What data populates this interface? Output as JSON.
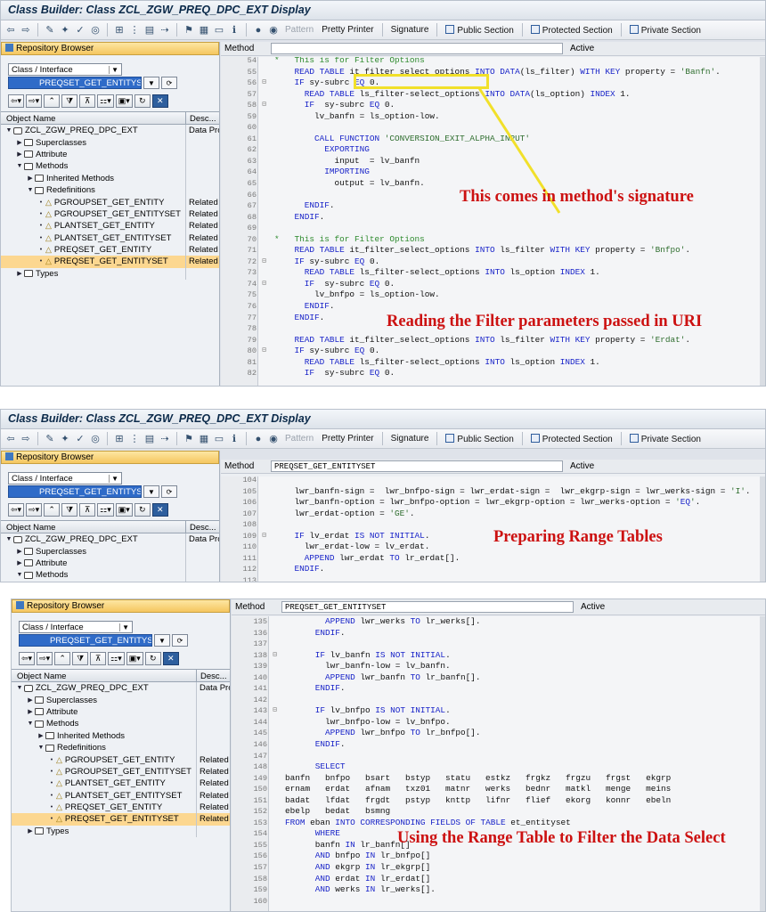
{
  "panels": [
    {
      "title": "Class Builder: Class ZCL_ZGW_PREQ_DPC_EXT Display",
      "toolbar": {
        "pattern": "Pattern",
        "pretty_printer": "Pretty Printer",
        "signature": "Signature",
        "public_section": "Public Section",
        "protected_section": "Protected Section",
        "private_section": "Private Section"
      },
      "repo_title": "Repository Browser",
      "class_select": "Class / Interface",
      "object_value": "PREQSET_GET_ENTITYSET",
      "col_object": "Object Name",
      "col_desc": "Desc...",
      "tree": [
        {
          "label": "ZCL_ZGW_PREQ_DPC_EXT",
          "desc": "Data Prov",
          "indent": 0,
          "icon": "class",
          "tw": "▼"
        },
        {
          "label": "Superclasses",
          "desc": "",
          "indent": 1,
          "icon": "folder",
          "tw": "▶"
        },
        {
          "label": "Attribute",
          "desc": "",
          "indent": 1,
          "icon": "folder",
          "tw": "▶"
        },
        {
          "label": "Methods",
          "desc": "",
          "indent": 1,
          "icon": "folder-open",
          "tw": "▼"
        },
        {
          "label": "Inherited Methods",
          "desc": "",
          "indent": 2,
          "icon": "folder",
          "tw": "▶"
        },
        {
          "label": "Redefinitions",
          "desc": "",
          "indent": 2,
          "icon": "folder-open",
          "tw": "▼"
        },
        {
          "label": "PGROUPSET_GET_ENTITY",
          "desc": "Related E",
          "indent": 3,
          "icon": "method",
          "tw": "•"
        },
        {
          "label": "PGROUPSET_GET_ENTITYSET",
          "desc": "Related E",
          "indent": 3,
          "icon": "method",
          "tw": "•"
        },
        {
          "label": "PLANTSET_GET_ENTITY",
          "desc": "Related E",
          "indent": 3,
          "icon": "method",
          "tw": "•"
        },
        {
          "label": "PLANTSET_GET_ENTITYSET",
          "desc": "Related E",
          "indent": 3,
          "icon": "method",
          "tw": "•"
        },
        {
          "label": "PREQSET_GET_ENTITY",
          "desc": "Related E",
          "indent": 3,
          "icon": "method",
          "tw": "•"
        },
        {
          "label": "PREQSET_GET_ENTITYSET",
          "desc": "Related E",
          "indent": 3,
          "icon": "method",
          "tw": "•",
          "selected": true
        },
        {
          "label": "Types",
          "desc": "",
          "indent": 1,
          "icon": "folder",
          "tw": "▶"
        }
      ],
      "method_label": "Method",
      "method_value": "",
      "method_status": "Active",
      "code": [
        {
          "n": "54",
          "t": "*   This is for Filter Options",
          "c": true
        },
        {
          "n": "55",
          "t": "    READ TABLE it_filter_select_options INTO DATA(ls_filter) WITH KEY property = 'Banfn'."
        },
        {
          "n": "56",
          "t": "    IF sy-subrc EQ 0.",
          "f": "⊟"
        },
        {
          "n": "57",
          "t": "      READ TABLE ls_filter-select_options INTO DATA(ls_option) INDEX 1."
        },
        {
          "n": "58",
          "t": "      IF  sy-subrc EQ 0.",
          "f": "⊟"
        },
        {
          "n": "59",
          "t": "        lv_banfn = ls_option-low."
        },
        {
          "n": "60",
          "t": ""
        },
        {
          "n": "61",
          "t": "        CALL FUNCTION 'CONVERSION_EXIT_ALPHA_INPUT'"
        },
        {
          "n": "62",
          "t": "          EXPORTING"
        },
        {
          "n": "63",
          "t": "            input  = lv_banfn"
        },
        {
          "n": "64",
          "t": "          IMPORTING"
        },
        {
          "n": "65",
          "t": "            output = lv_banfn."
        },
        {
          "n": "66",
          "t": ""
        },
        {
          "n": "67",
          "t": "      ENDIF."
        },
        {
          "n": "68",
          "t": "    ENDIF."
        },
        {
          "n": "69",
          "t": ""
        },
        {
          "n": "70",
          "t": "*   This is for Filter Options",
          "c": true
        },
        {
          "n": "71",
          "t": "    READ TABLE it_filter_select_options INTO ls_filter WITH KEY property = 'Bnfpo'."
        },
        {
          "n": "72",
          "t": "    IF sy-subrc EQ 0.",
          "f": "⊟"
        },
        {
          "n": "73",
          "t": "      READ TABLE ls_filter-select_options INTO ls_option INDEX 1."
        },
        {
          "n": "74",
          "t": "      IF  sy-subrc EQ 0.",
          "f": "⊟"
        },
        {
          "n": "75",
          "t": "        lv_bnfpo = ls_option-low."
        },
        {
          "n": "76",
          "t": "      ENDIF."
        },
        {
          "n": "77",
          "t": "    ENDIF."
        },
        {
          "n": "78",
          "t": ""
        },
        {
          "n": "79",
          "t": "    READ TABLE it_filter_select_options INTO ls_filter WITH KEY property = 'Erdat'."
        },
        {
          "n": "80",
          "t": "    IF sy-subrc EQ 0.",
          "f": "⊟"
        },
        {
          "n": "81",
          "t": "      READ TABLE ls_filter-select_options INTO ls_option INDEX 1."
        },
        {
          "n": "82",
          "t": "      IF  sy-subrc EQ 0."
        }
      ],
      "annotations": [
        "This comes in method's signature",
        "Reading the Filter parameters passed in URI"
      ]
    },
    {
      "title": "Class Builder: Class ZCL_ZGW_PREQ_DPC_EXT Display",
      "toolbar": {
        "pattern": "Pattern",
        "pretty_printer": "Pretty Printer",
        "signature": "Signature",
        "public_section": "Public Section",
        "protected_section": "Protected Section",
        "private_section": "Private Section"
      },
      "repo_title": "Repository Browser",
      "class_select": "Class / Interface",
      "object_value": "PREQSET_GET_ENTITYSET",
      "col_object": "Object Name",
      "col_desc": "Desc...",
      "tree": [
        {
          "label": "ZCL_ZGW_PREQ_DPC_EXT",
          "desc": "Data Prov",
          "indent": 0,
          "icon": "class",
          "tw": "▼"
        },
        {
          "label": "Superclasses",
          "desc": "",
          "indent": 1,
          "icon": "folder",
          "tw": "▶"
        },
        {
          "label": "Attribute",
          "desc": "",
          "indent": 1,
          "icon": "folder",
          "tw": "▶"
        },
        {
          "label": "Methods",
          "desc": "",
          "indent": 1,
          "icon": "folder-open",
          "tw": "▼"
        }
      ],
      "method_label": "Method",
      "method_value": "PREQSET_GET_ENTITYSET",
      "method_status": "Active",
      "code": [
        {
          "n": "104",
          "t": ""
        },
        {
          "n": "105",
          "t": "    lwr_banfn-sign =  lwr_bnfpo-sign = lwr_erdat-sign =  lwr_ekgrp-sign = lwr_werks-sign = 'I'."
        },
        {
          "n": "106",
          "t": "    lwr_banfn-option = lwr_bnfpo-option = lwr_ekgrp-option = lwr_werks-option = 'EQ'."
        },
        {
          "n": "107",
          "t": "    lwr_erdat-option = 'GE'."
        },
        {
          "n": "108",
          "t": ""
        },
        {
          "n": "109",
          "t": "    IF lv_erdat IS NOT INITIAL.",
          "f": "⊟"
        },
        {
          "n": "110",
          "t": "      lwr_erdat-low = lv_erdat."
        },
        {
          "n": "111",
          "t": "      APPEND lwr_erdat TO lr_erdat[]."
        },
        {
          "n": "112",
          "t": "    ENDIF."
        },
        {
          "n": "113",
          "t": ""
        }
      ],
      "annotations": [
        "Preparing Range Tables"
      ]
    },
    {
      "title": "",
      "repo_title": "Repository Browser",
      "class_select": "Class / Interface",
      "object_value": "PREQSET_GET_ENTITYSET",
      "col_object": "Object Name",
      "col_desc": "Desc...",
      "tree": [
        {
          "label": "ZCL_ZGW_PREQ_DPC_EXT",
          "desc": "Data Prov",
          "indent": 0,
          "icon": "class",
          "tw": "▼"
        },
        {
          "label": "Superclasses",
          "desc": "",
          "indent": 1,
          "icon": "folder",
          "tw": "▶"
        },
        {
          "label": "Attribute",
          "desc": "",
          "indent": 1,
          "icon": "folder",
          "tw": "▶"
        },
        {
          "label": "Methods",
          "desc": "",
          "indent": 1,
          "icon": "folder-open",
          "tw": "▼"
        },
        {
          "label": "Inherited Methods",
          "desc": "",
          "indent": 2,
          "icon": "folder",
          "tw": "▶"
        },
        {
          "label": "Redefinitions",
          "desc": "",
          "indent": 2,
          "icon": "folder-open",
          "tw": "▼"
        },
        {
          "label": "PGROUPSET_GET_ENTITY",
          "desc": "Related E",
          "indent": 3,
          "icon": "method",
          "tw": "•"
        },
        {
          "label": "PGROUPSET_GET_ENTITYSET",
          "desc": "Related E",
          "indent": 3,
          "icon": "method",
          "tw": "•"
        },
        {
          "label": "PLANTSET_GET_ENTITY",
          "desc": "Related E",
          "indent": 3,
          "icon": "method",
          "tw": "•"
        },
        {
          "label": "PLANTSET_GET_ENTITYSET",
          "desc": "Related E",
          "indent": 3,
          "icon": "method",
          "tw": "•"
        },
        {
          "label": "PREQSET_GET_ENTITY",
          "desc": "Related E",
          "indent": 3,
          "icon": "method",
          "tw": "•"
        },
        {
          "label": "PREQSET_GET_ENTITYSET",
          "desc": "Related E",
          "indent": 3,
          "icon": "method",
          "tw": "•",
          "selected": true
        },
        {
          "label": "Types",
          "desc": "",
          "indent": 1,
          "icon": "folder",
          "tw": "▶"
        }
      ],
      "method_label": "Method",
      "method_value": "PREQSET_GET_ENTITYSET",
      "method_status": "Active",
      "code": [
        {
          "n": "135",
          "t": "        APPEND lwr_werks TO lr_werks[]."
        },
        {
          "n": "136",
          "t": "      ENDIF."
        },
        {
          "n": "137",
          "t": ""
        },
        {
          "n": "138",
          "t": "      IF lv_banfn IS NOT INITIAL.",
          "f": "⊟"
        },
        {
          "n": "139",
          "t": "        lwr_banfn-low = lv_banfn."
        },
        {
          "n": "140",
          "t": "        APPEND lwr_banfn TO lr_banfn[]."
        },
        {
          "n": "141",
          "t": "      ENDIF."
        },
        {
          "n": "142",
          "t": ""
        },
        {
          "n": "143",
          "t": "      IF lv_bnfpo IS NOT INITIAL.",
          "f": "⊟"
        },
        {
          "n": "144",
          "t": "        lwr_bnfpo-low = lv_bnfpo."
        },
        {
          "n": "145",
          "t": "        APPEND lwr_bnfpo TO lr_bnfpo[]."
        },
        {
          "n": "146",
          "t": "      ENDIF."
        },
        {
          "n": "147",
          "t": ""
        },
        {
          "n": "148",
          "t": "      SELECT"
        },
        {
          "n": "149",
          "t": "banfn   bnfpo   bsart   bstyp   statu   estkz   frgkz   frgzu   frgst   ekgrp"
        },
        {
          "n": "150",
          "t": "ernam   erdat   afnam   txz01   matnr   werks   bednr   matkl   menge   meins"
        },
        {
          "n": "151",
          "t": "badat   lfdat   frgdt   pstyp   knttp   lifnr   flief   ekorg   konnr   ebeln"
        },
        {
          "n": "152",
          "t": "ebelp   bedat   bsmng"
        },
        {
          "n": "153",
          "t": "FROM eban INTO CORRESPONDING FIELDS OF TABLE et_entityset"
        },
        {
          "n": "154",
          "t": "      WHERE"
        },
        {
          "n": "155",
          "t": "      banfn IN lr_banfn[]"
        },
        {
          "n": "156",
          "t": "      AND bnfpo IN lr_bnfpo[]"
        },
        {
          "n": "157",
          "t": "      AND ekgrp IN lr_ekgrp[]"
        },
        {
          "n": "158",
          "t": "      AND erdat IN lr_erdat[]"
        },
        {
          "n": "159",
          "t": "      AND werks IN lr_werks[]."
        },
        {
          "n": "160",
          "t": ""
        }
      ],
      "annotations": [
        "Using the Range Table to Filter the Data Select"
      ]
    }
  ],
  "colors": {
    "annotation": "#cc1111",
    "highlight": "#f1e02a",
    "selected_row": "#fcd790",
    "keyword": "#1a25c9",
    "comment": "#2d8a2d"
  }
}
